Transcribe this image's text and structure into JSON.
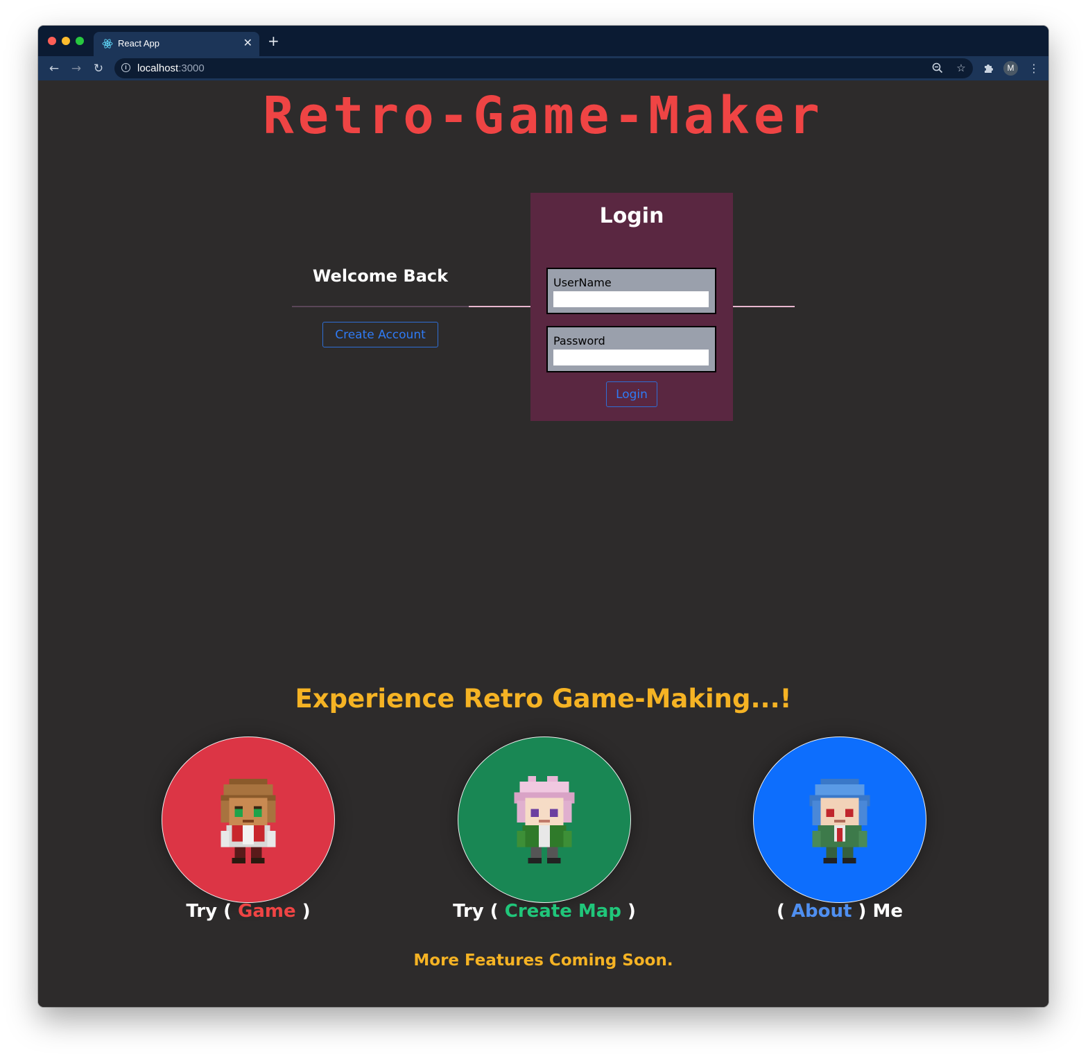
{
  "browser": {
    "tab_title": "React App",
    "url_host": "localhost",
    "url_port": ":3000",
    "profile_initial": "M"
  },
  "site": {
    "title": "Retro-Game-Maker"
  },
  "welcome": {
    "heading": "Welcome Back",
    "create_account_label": "Create Account"
  },
  "login": {
    "title": "Login",
    "username_label": "UserName",
    "username_value": "",
    "password_label": "Password",
    "password_value": "",
    "submit_label": "Login"
  },
  "features": {
    "heading": "Experience Retro Game-Making...!",
    "items": [
      {
        "prefix": "Try ( ",
        "link": "Game",
        "suffix": " )",
        "color": "#dc3545",
        "link_color": "#ef4444",
        "icon": "character-brown-hair-icon"
      },
      {
        "prefix": "Try ( ",
        "link": "Create Map",
        "suffix": " )",
        "color": "#198754",
        "link_color": "#20c67a",
        "icon": "character-pink-hair-icon"
      },
      {
        "prefix": "( ",
        "link": "About",
        "suffix": " ) Me",
        "color": "#0d6efd",
        "link_color": "#4f8ff0",
        "icon": "character-blue-hair-icon"
      }
    ],
    "footer": "More Features Coming Soon."
  },
  "colors": {
    "page_background": "#2d2b2b",
    "title_red": "#ef4444",
    "accent_yellow": "#f5b324",
    "login_card": "#5a2741",
    "button_blue": "#2f7bf5"
  }
}
